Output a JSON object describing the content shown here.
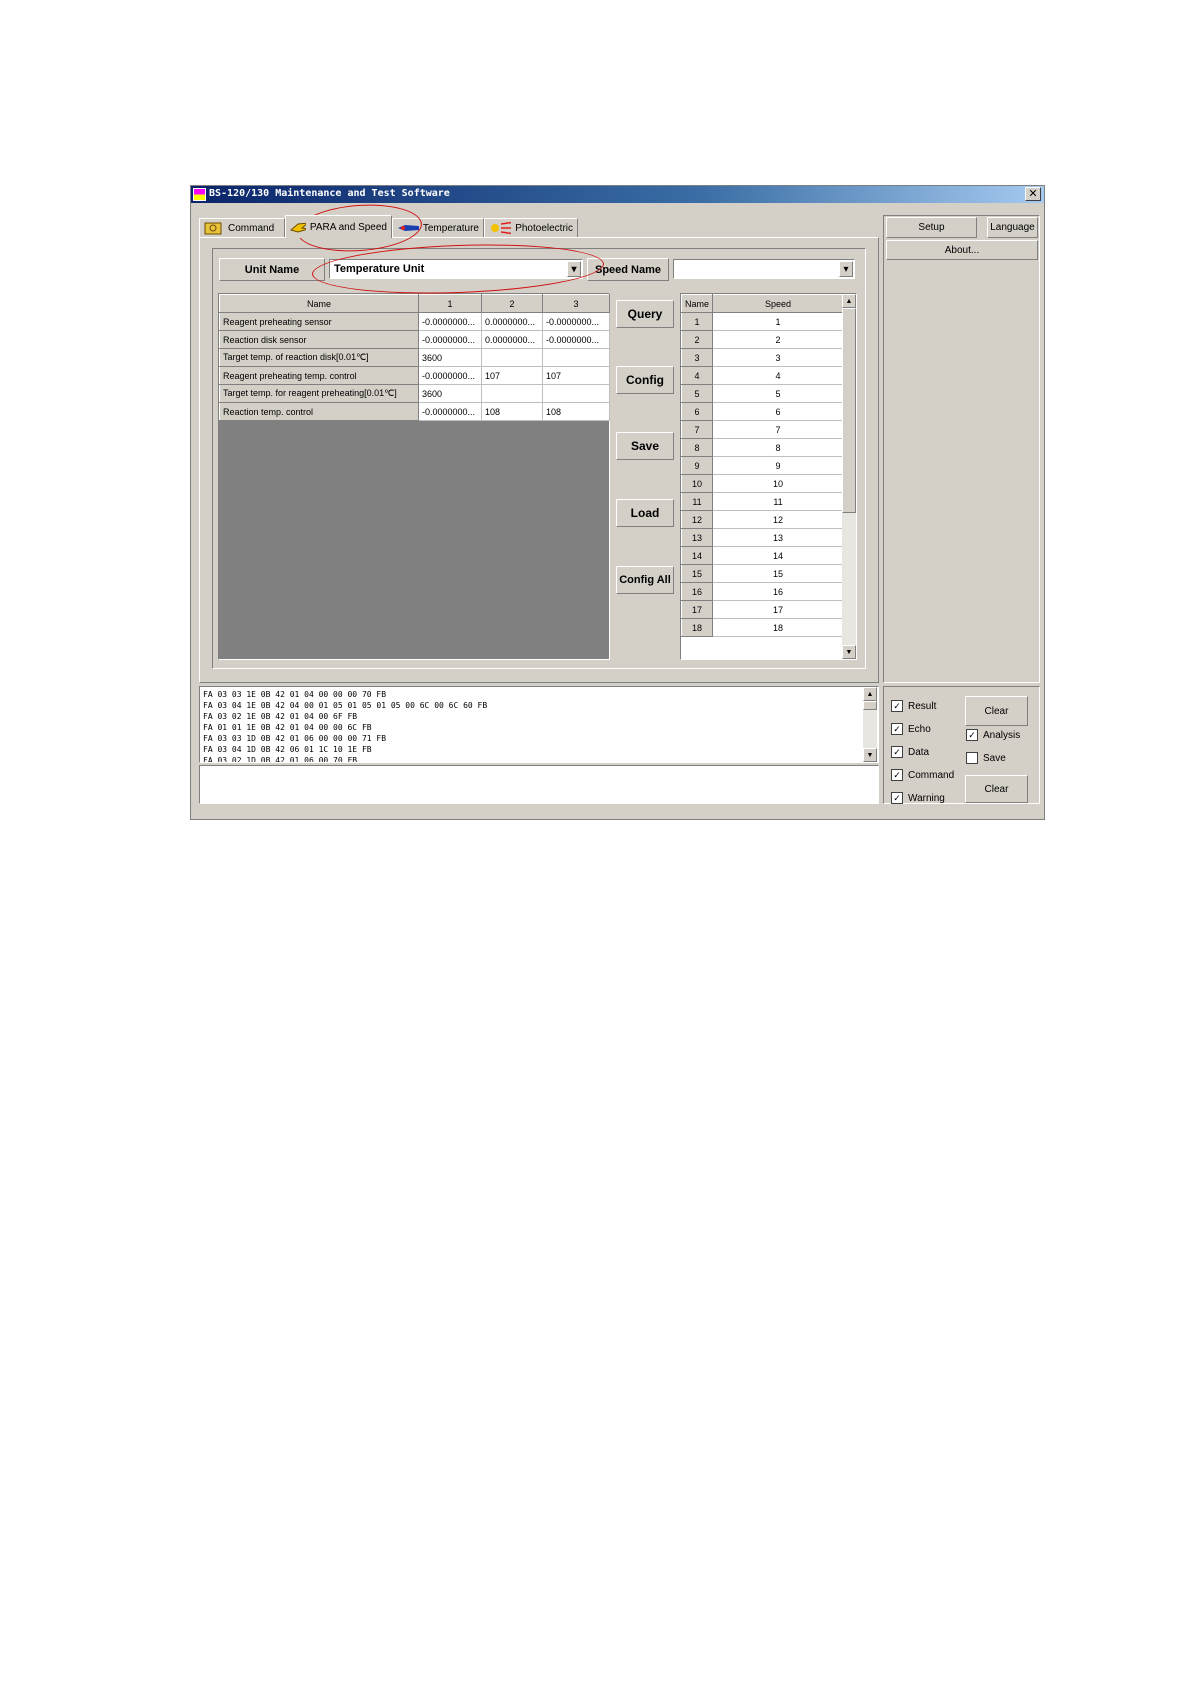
{
  "window": {
    "title": "BS-120/130 Maintenance and Test Software",
    "close_symbol": "✕"
  },
  "tabs": [
    {
      "label": "Command",
      "icon": "gear-icon",
      "active": false
    },
    {
      "label": "PARA and Speed",
      "icon": "hand-icon",
      "active": true
    },
    {
      "label": "Temperature",
      "icon": "thermometer-icon",
      "active": false
    },
    {
      "label": "Photoelectric",
      "icon": "lamp-icon",
      "active": false
    }
  ],
  "unit": {
    "label": "Unit Name",
    "value": "Temperature Unit"
  },
  "speed": {
    "label": "Speed Name",
    "value": ""
  },
  "param_table": {
    "headers": [
      "Name",
      "1",
      "2",
      "3"
    ],
    "rows": [
      [
        "Reagent preheating sensor",
        "-0.0000000...",
        "0.0000000...",
        "-0.0000000..."
      ],
      [
        "Reaction disk sensor",
        "-0.0000000...",
        "0.0000000...",
        "-0.0000000..."
      ],
      [
        "Target temp. of reaction disk[0.01℃]",
        "3600",
        "",
        ""
      ],
      [
        "Reagent preheating temp. control",
        "-0.0000000...",
        "107",
        "107"
      ],
      [
        "Target temp. for reagent preheating[0.01℃]",
        "3600",
        "",
        ""
      ],
      [
        "Reaction temp. control",
        "-0.0000000...",
        "108",
        "108"
      ]
    ]
  },
  "actions": {
    "query": "Query",
    "config": "Config",
    "save": "Save",
    "load": "Load",
    "config_all": "Config All"
  },
  "speed_table": {
    "headers": [
      "Name",
      "Speed"
    ],
    "rows": [
      [
        "1",
        "1"
      ],
      [
        "2",
        "2"
      ],
      [
        "3",
        "3"
      ],
      [
        "4",
        "4"
      ],
      [
        "5",
        "5"
      ],
      [
        "6",
        "6"
      ],
      [
        "7",
        "7"
      ],
      [
        "8",
        "8"
      ],
      [
        "9",
        "9"
      ],
      [
        "10",
        "10"
      ],
      [
        "11",
        "11"
      ],
      [
        "12",
        "12"
      ],
      [
        "13",
        "13"
      ],
      [
        "14",
        "14"
      ],
      [
        "15",
        "15"
      ],
      [
        "16",
        "16"
      ],
      [
        "17",
        "17"
      ],
      [
        "18",
        "18"
      ]
    ]
  },
  "right_panel": {
    "setup": "Setup",
    "language": "Language",
    "about": "About..."
  },
  "log": {
    "lines": [
      "FA 03 03 1E 0B 42 01 04 00 00 00 70 FB",
      "FA 03 04 1E 0B 42 04 00 01 05 01 05 01 05 00 6C 00 6C 60 FB",
      "FA 03 02 1E 0B 42 01 04 00 6F FB",
      "FA 01 01 1E 0B 42 01 04 00 00 6C FB",
      "FA 03 03 1D 0B 42 01 06 00 00 00 71 FB",
      "FA 03 04 1D 0B 42 06 01 1C 10 1E FB",
      "FA 03 02 1D 0B 42 01 06 00 70 FB"
    ],
    "command_input": ""
  },
  "filters": {
    "result": {
      "label": "Result",
      "checked": true
    },
    "echo": {
      "label": "Echo",
      "checked": true
    },
    "data": {
      "label": "Data",
      "checked": true
    },
    "command": {
      "label": "Command",
      "checked": true
    },
    "warning": {
      "label": "Warning",
      "checked": true
    },
    "analysis": {
      "label": "Analysis",
      "checked": true
    },
    "save": {
      "label": "Save",
      "checked": false
    },
    "clear_top": "Clear",
    "clear_bottom": "Clear"
  },
  "annotation_color": "#d01010"
}
